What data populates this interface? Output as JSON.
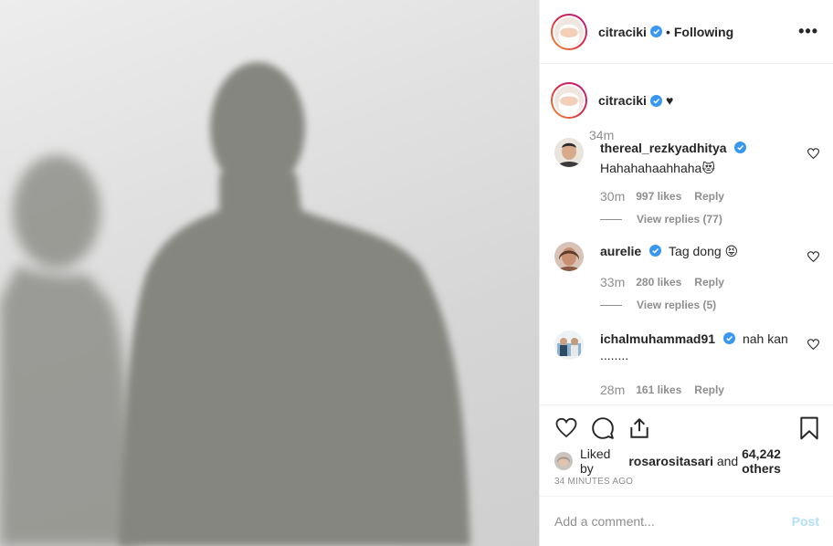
{
  "post": {
    "image_alt": "Shadows of two people on a wall",
    "author": "citraciki",
    "follow_status": "Following",
    "separator": "•",
    "more_icon": "more-options-icon",
    "caption": {
      "username": "citraciki",
      "text": "♥",
      "time": "34m"
    }
  },
  "comments": [
    {
      "username": "thereal_rezkyadhitya",
      "text": "Hahahahaahhaha😻",
      "time": "30m",
      "likes": "997 likes",
      "reply": "Reply",
      "view_replies": "View replies (77)"
    },
    {
      "username": "aurelie",
      "text": "Tag dong 😝",
      "time": "33m",
      "likes": "280 likes",
      "reply": "Reply",
      "view_replies": "View replies (5)"
    },
    {
      "username": "ichalmuhammad91",
      "text": "nah kan ........",
      "time": "28m",
      "likes": "161 likes",
      "reply": "Reply"
    }
  ],
  "actions": {
    "liked_by_prefix": "Liked by",
    "liked_by_user": "rosarositasari",
    "liked_by_and": "and",
    "liked_by_others": "64,242 others",
    "posted_ago": "34 MINUTES AGO"
  },
  "add_comment": {
    "placeholder": "Add a comment...",
    "post_label": "Post"
  },
  "colors": {
    "verified": "#3897f0",
    "post_disabled": "#b2dffc",
    "muted": "#8e8e8e"
  }
}
